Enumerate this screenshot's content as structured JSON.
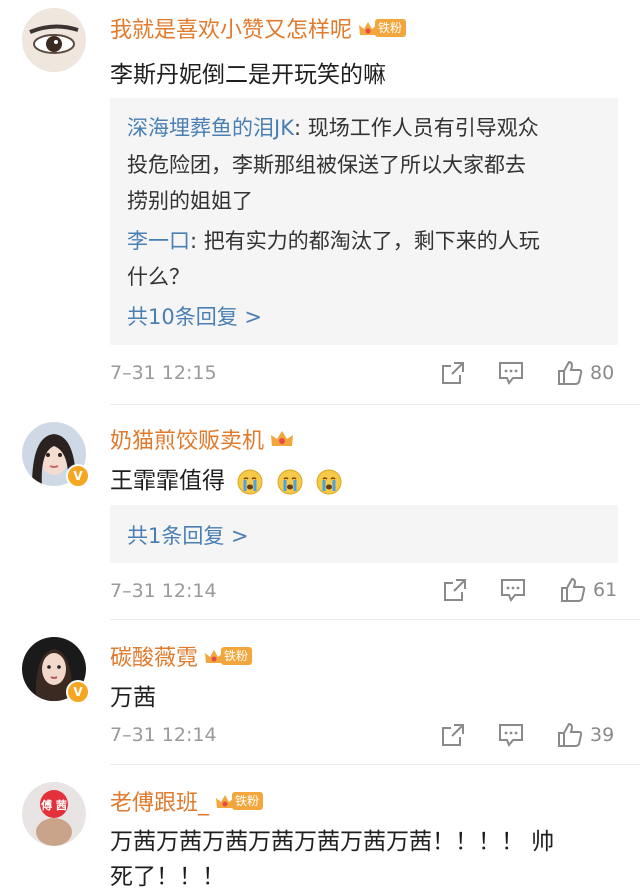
{
  "comments": [
    {
      "username": "我就是喜欢小赞又怎样呢",
      "badge": "铁粉",
      "text": "李斯丹妮倒二是开玩笑的嘛",
      "replies": [
        {
          "author": "深海埋葬鱼的泪JK",
          "line1": "现场工作人员有引导观众",
          "line2": "投危险团，李斯那组被保送了所以大家都去",
          "line3": "捞别的姐姐了"
        },
        {
          "author": "李一口",
          "line1": "把有实力的都淘汰了，剩下来的人玩",
          "line2": "什么？"
        }
      ],
      "more_replies": "共10条回复 >",
      "time": "7–31 12:15",
      "likes": "80"
    },
    {
      "username": "奶猫煎饺贩卖机",
      "text": "王霏霏值得",
      "more_replies": "共1条回复 >",
      "time": "7–31 12:14",
      "likes": "61"
    },
    {
      "username": "碳酸薇霓",
      "badge": "铁粉",
      "text": "万茜",
      "time": "7–31 12:14",
      "likes": "39"
    },
    {
      "username": "老傅跟班_",
      "badge": "铁粉",
      "avatar_text": "傅 茜",
      "text": "万茜万茜万茜万茜万茜万茜万茜！！！！ 帅",
      "text2": "死了！！！"
    }
  ],
  "colors": {
    "username": "#e27a2c",
    "link": "#4a7fb4",
    "badge": "#f3a63b",
    "meta": "#9a9a9a"
  },
  "icons": [
    "share-icon",
    "comment-icon",
    "like-icon",
    "crying-emoji-icon",
    "crown-icon",
    "verified-icon"
  ]
}
